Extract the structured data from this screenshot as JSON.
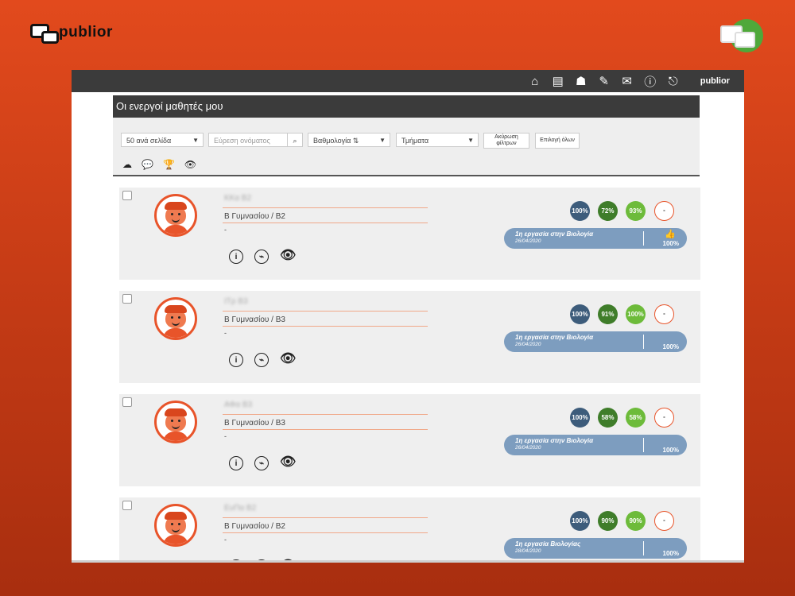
{
  "brand": {
    "name": "publior",
    "mini": "publior"
  },
  "topbar": {
    "icons": [
      "home-icon",
      "layout-icon",
      "sitemap-icon",
      "edit-icon",
      "mail-icon",
      "info-icon",
      "exit-icon"
    ],
    "glyphs": [
      "⌂",
      "▤",
      "☗",
      "✎",
      "✉",
      "ⓘ",
      "⎋"
    ]
  },
  "header": {
    "title": "Οι ενεργοί μαθητές μου"
  },
  "filters": {
    "per_page": "50 ανά σελίδα",
    "search_placeholder": "Εύρεση ονόματος",
    "search_btn": "⌕",
    "grading": "Βαθμολογία ⇅",
    "sections": "Τμήματα",
    "clear": "Ακύρωση φίλτρων",
    "select_all": "Επιλογή όλων",
    "caret": "▼"
  },
  "actions": {
    "download": "☁",
    "comments": "💬",
    "trophy": "🏆",
    "view": "👁"
  },
  "students": [
    {
      "name": "ΚΚα Β2",
      "class": "Β Γυμνασίου / Β2",
      "dash": "-",
      "stats": [
        "100%",
        "72%",
        "93%",
        "-"
      ],
      "task": {
        "title": "1η εργασία στην Βιολογία",
        "date": "26/04/2020",
        "pct": "100%",
        "thumb": "👍"
      }
    },
    {
      "name": "ΙΤρ Β3",
      "class": "Β Γυμνασίου / Β3",
      "dash": "-",
      "stats": [
        "100%",
        "91%",
        "100%",
        "-"
      ],
      "task": {
        "title": "1η εργασία στην Βιολογία",
        "date": "26/04/2020",
        "pct": "100%",
        "thumb": ""
      }
    },
    {
      "name": "ΑΦα Β3",
      "class": "Β Γυμνασίου / Β3",
      "dash": "-",
      "stats": [
        "100%",
        "58%",
        "58%",
        "-"
      ],
      "task": {
        "title": "1η εργασία στην Βιολογία",
        "date": "26/04/2020",
        "pct": "100%",
        "thumb": ""
      }
    },
    {
      "name": "ΕυΠα Β2",
      "class": "Β Γυμνασίου / Β2",
      "dash": "-",
      "stats": [
        "100%",
        "90%",
        "90%",
        "-"
      ],
      "task": {
        "title": "1η εργασία Βιολογίας",
        "date": "28/04/2020",
        "pct": "100%",
        "thumb": ""
      }
    }
  ],
  "card_icons": {
    "info": "i",
    "chart": "⌁",
    "view": "👁"
  },
  "colors": {
    "accent": "#e8542a",
    "stat1": "#3d5c7b",
    "stat2": "#3f7d2a",
    "stat3": "#6dbb3a",
    "task_bar": "#7d9dbf"
  }
}
